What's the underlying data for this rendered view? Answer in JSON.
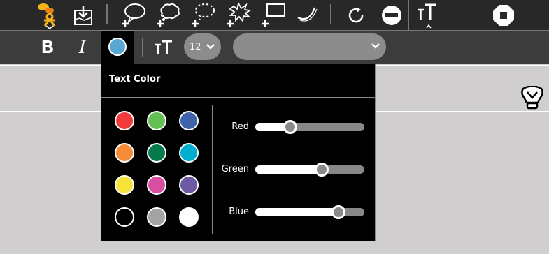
{
  "toolbar": {
    "icons": [
      "activity-icon",
      "save-to-journal-icon",
      "add-speech-bubble-icon",
      "add-thought-bubble-icon",
      "add-whisper-bubble-icon",
      "add-exclamation-bubble-icon",
      "add-box-icon",
      "add-curve-icon",
      "redo-icon",
      "remove-icon",
      "text-format-icon",
      "stop-icon"
    ]
  },
  "format_bar": {
    "bold_label": "B",
    "italic_label": "I",
    "current_color": "#5aa7d3",
    "font_size": "12",
    "font_name": ""
  },
  "palette": {
    "title": "Text Color",
    "swatches": [
      "#f23a3a",
      "#64bf54",
      "#3d64aa",
      "#f58b37",
      "#077a4b",
      "#00aed0",
      "#f6e43b",
      "#d84ea3",
      "#6e59a5",
      "#000000",
      "#a3a3a3",
      "#ffffff"
    ],
    "sliders": [
      {
        "label": "Red",
        "value": 0.32
      },
      {
        "label": "Green",
        "value": 0.61
      },
      {
        "label": "Blue",
        "value": 0.76
      }
    ]
  }
}
